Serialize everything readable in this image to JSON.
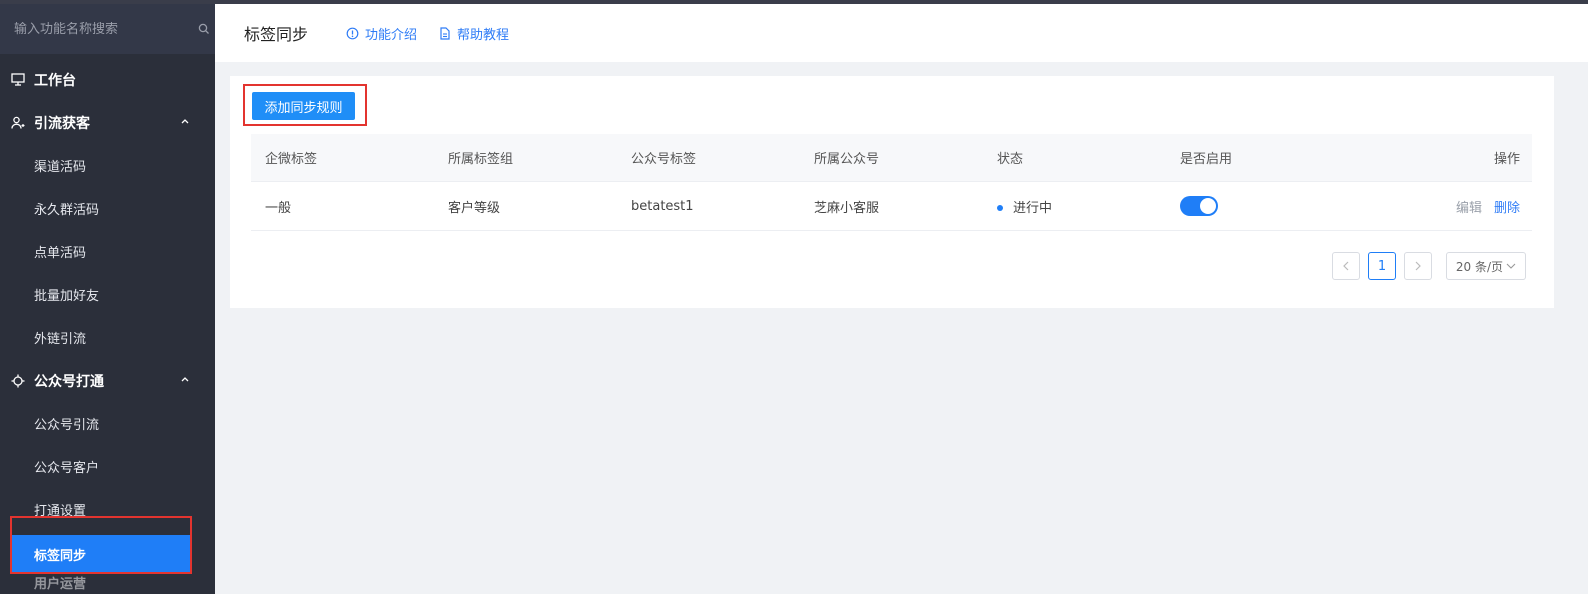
{
  "sidebar": {
    "search_placeholder": "输入功能名称搜索",
    "groups": [
      {
        "label": "工作台",
        "icon": "monitor-icon"
      },
      {
        "label": "引流获客",
        "icon": "user-add-icon",
        "items": [
          "渠道活码",
          "永久群活码",
          "点单活码",
          "批量加好友",
          "外链引流"
        ]
      },
      {
        "label": "公众号打通",
        "icon": "crosshair-icon",
        "items": [
          "公众号引流",
          "公众号客户",
          "打通设置",
          "标签同步"
        ]
      }
    ],
    "peek_label": "用户运营"
  },
  "header": {
    "title": "标签同步",
    "link_intro": "功能介绍",
    "link_help": "帮助教程"
  },
  "toolbar": {
    "add_label": "添加同步规则"
  },
  "table": {
    "columns": [
      "企微标签",
      "所属标签组",
      "公众号标签",
      "所属公众号",
      "状态",
      "是否启用",
      "操作"
    ],
    "rows": [
      {
        "tag": "一般",
        "group": "客户等级",
        "mp_tag": "betatest1",
        "mp": "芝麻小客服",
        "status": "进行中",
        "enabled": true,
        "edit": "编辑",
        "delete": "删除"
      }
    ]
  },
  "pagination": {
    "current": "1",
    "page_size": "20 条/页"
  },
  "colors": {
    "accent": "#1f7ef7",
    "sidebar_bg": "#2b2f3a",
    "highlight": "#e3342f"
  }
}
